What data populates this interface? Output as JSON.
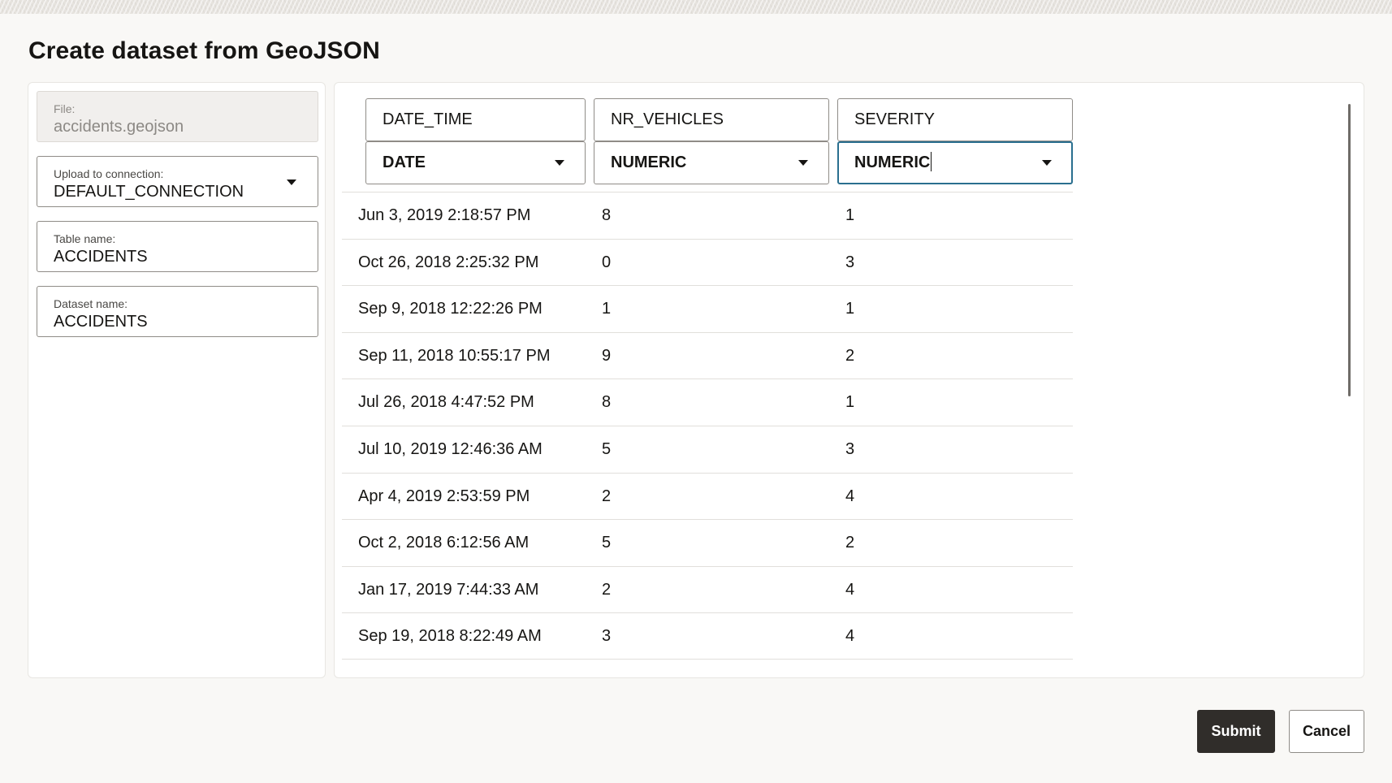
{
  "dialog": {
    "title": "Create dataset from GeoJSON"
  },
  "left_form": {
    "file": {
      "label": "File:",
      "value": "accidents.geojson",
      "readonly": true
    },
    "connection": {
      "label": "Upload to connection:",
      "value": "DEFAULT_CONNECTION"
    },
    "table_name": {
      "label": "Table name:",
      "value": "ACCIDENTS"
    },
    "dataset_name": {
      "label": "Dataset name:",
      "value": "ACCIDENTS"
    }
  },
  "columns": [
    {
      "name": "DATE_TIME",
      "type": "DATE"
    },
    {
      "name": "NR_VEHICLES",
      "type": "NUMERIC"
    },
    {
      "name": "SEVERITY",
      "type": "NUMERIC"
    }
  ],
  "rows": [
    [
      "Jun 3, 2019 2:18:57 PM",
      "8",
      "1"
    ],
    [
      "Oct 26, 2018 2:25:32 PM",
      "0",
      "3"
    ],
    [
      "Sep 9, 2018 12:22:26 PM",
      "1",
      "1"
    ],
    [
      "Sep 11, 2018 10:55:17 PM",
      "9",
      "2"
    ],
    [
      "Jul 26, 2018 4:47:52 PM",
      "8",
      "1"
    ],
    [
      "Jul 10, 2019 12:46:36 AM",
      "5",
      "3"
    ],
    [
      "Apr 4, 2019 2:53:59 PM",
      "2",
      "4"
    ],
    [
      "Oct 2, 2018 6:12:56 AM",
      "5",
      "2"
    ],
    [
      "Jan 17, 2019 7:44:33 AM",
      "2",
      "4"
    ],
    [
      "Sep 19, 2018 8:22:49 AM",
      "3",
      "4"
    ]
  ],
  "footer": {
    "submit_label": "Submit",
    "cancel_label": "Cancel"
  },
  "icons": {
    "dropdown": "chevron-down-icon"
  },
  "colors": {
    "focus_border": "#2a6f8f",
    "primary_button": "#302d2a"
  }
}
